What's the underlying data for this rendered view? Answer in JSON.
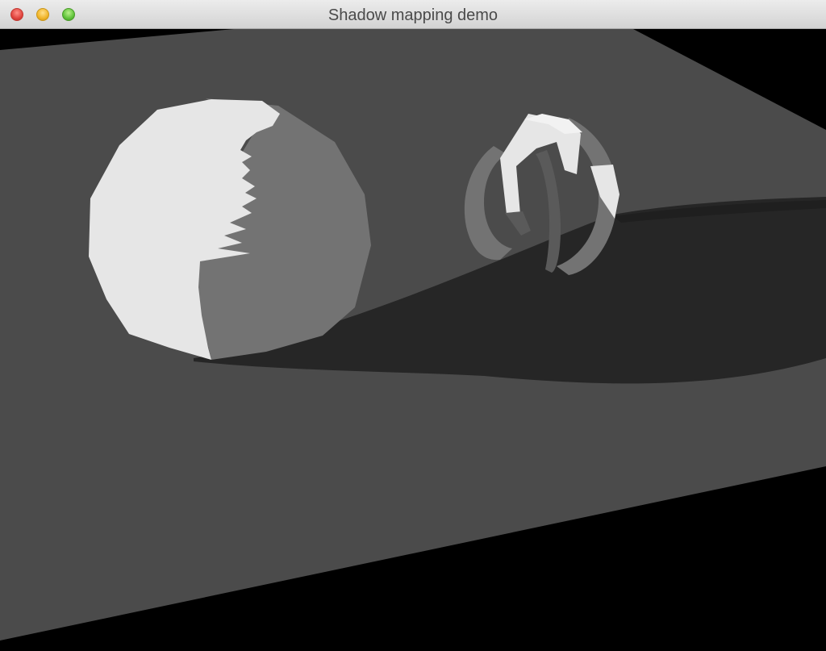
{
  "window": {
    "title": "Shadow mapping demo",
    "buttons": {
      "close": "close-window",
      "minimize": "minimize-window",
      "zoom": "zoom-window"
    }
  },
  "scene": {
    "background_color": "#000000",
    "floor_color": "#4b4b4b",
    "shadow_color": "#262626",
    "lit_color": "#e6e6e6",
    "unlit_color": "#737373"
  }
}
